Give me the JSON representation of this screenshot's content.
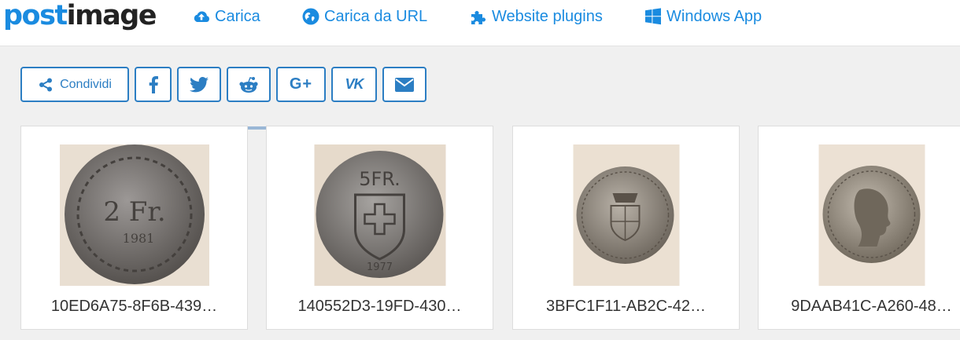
{
  "header": {
    "logo_part1": "post",
    "logo_part2": "image",
    "nav": [
      {
        "label": "Carica",
        "icon": "cloud-upload-icon"
      },
      {
        "label": "Carica da URL",
        "icon": "globe-icon"
      },
      {
        "label": "Website plugins",
        "icon": "puzzle-icon"
      },
      {
        "label": "Windows App",
        "icon": "windows-icon"
      }
    ]
  },
  "share": {
    "share_label": "Condividi",
    "buttons": [
      "share-icon",
      "facebook-icon",
      "twitter-icon",
      "reddit-icon",
      "google-plus-icon",
      "vk-icon",
      "email-icon"
    ],
    "google_plus_text": "G+",
    "vk_text": "VK"
  },
  "gallery": {
    "items": [
      {
        "filename": "10ED6A75-8F6B-439…",
        "coin_text": "2 Fr.",
        "coin_year": "1981"
      },
      {
        "filename": "140552D3-19FD-430…",
        "coin_text": "5FR.",
        "coin_year": "1977"
      },
      {
        "filename": "3BFC1F11-AB2C-42…"
      },
      {
        "filename": "9DAAB41C-A260-48…"
      }
    ]
  },
  "colors": {
    "brand_blue": "#1a8be0",
    "button_blue": "#2c7ec3",
    "background": "#f0f0f0"
  }
}
